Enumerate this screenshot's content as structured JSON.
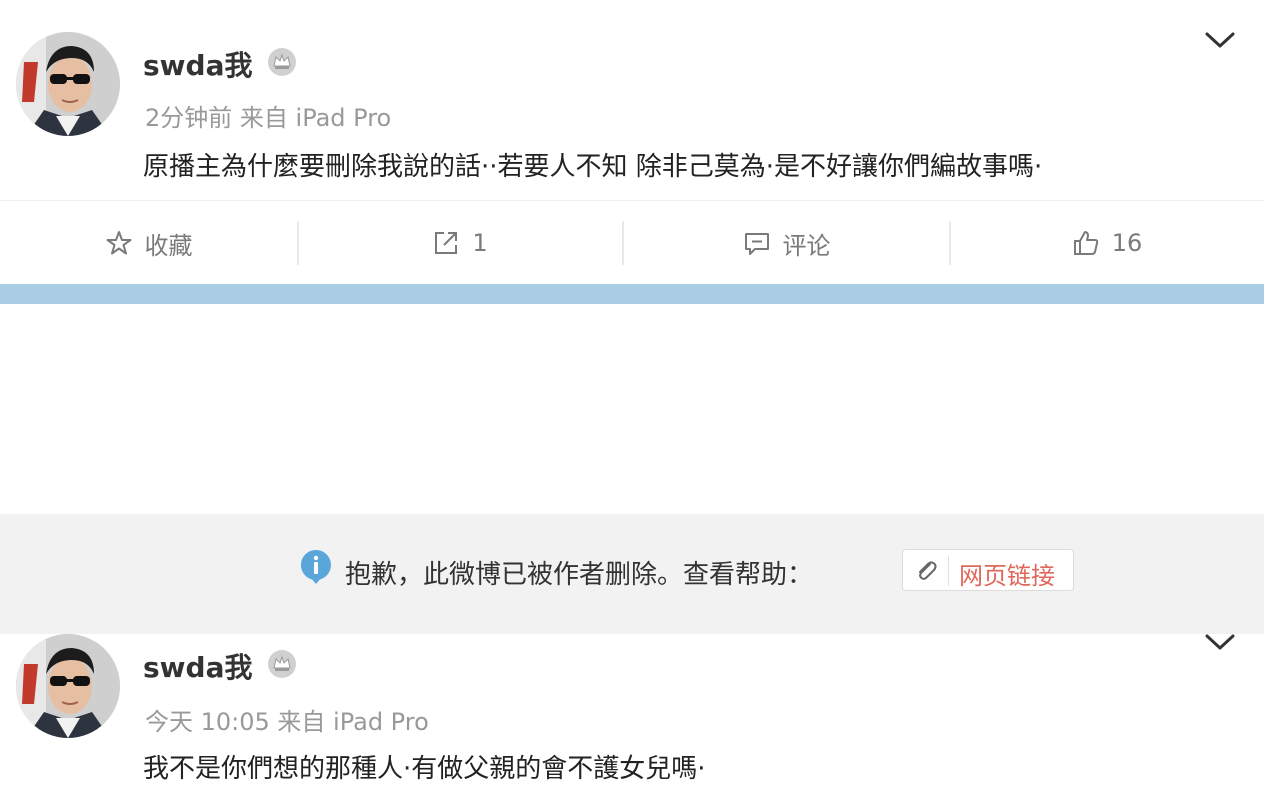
{
  "posts": [
    {
      "username": "swda我",
      "meta": "2分钟前 来自 iPad Pro",
      "content": "原播主為什麼要刪除我說的話··若要人不知 除非己莫為·是不好讓你們編故事嗎·"
    },
    {
      "username": "swda我",
      "meta": "今天 10:05 来自 iPad Pro",
      "content": "我不是你們想的那種人·有做父親的會不護女兒嗎·"
    }
  ],
  "actions": {
    "favorite_label": "收藏",
    "repost_count": "1",
    "comment_label": "评论",
    "like_count": "16"
  },
  "icons": {
    "badge": "crown-badge-icon",
    "menu": "chevron-down-icon",
    "favorite": "star-icon",
    "repost": "share-icon",
    "comment": "comment-icon",
    "like": "thumbs-up-icon",
    "info": "info-icon",
    "link": "paperclip-icon"
  },
  "deleted_notice": {
    "text": "抱歉，此微博已被作者删除。查看帮助：",
    "link_label": "网页链接"
  },
  "colors": {
    "separator": "#aacde6",
    "link_text": "#e0685b",
    "info_icon": "#5aa6db"
  }
}
